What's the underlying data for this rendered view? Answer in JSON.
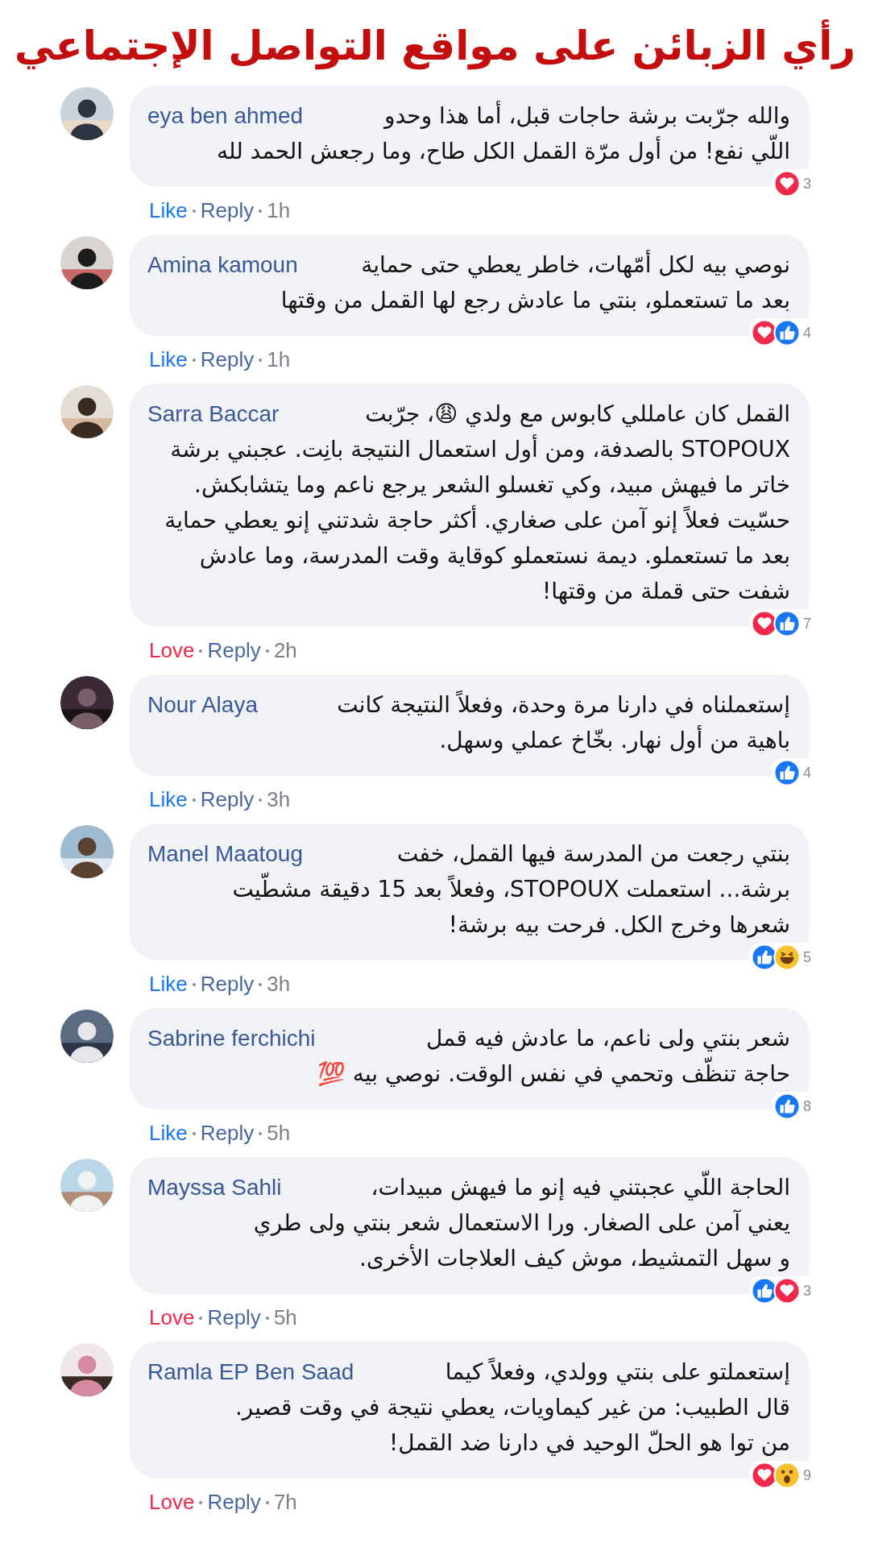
{
  "title": "رأي الزبائن على مواقع التواصل الإجتماعي",
  "comments": [
    {
      "name": "eya ben ahmed",
      "lines": [
        "والله جرّبت برشة حاجات قبل، أما هذا وحدو",
        "اللّي نفع! من أول مرّة القمل الكل طاح، وما رجعش الحمد لله"
      ],
      "reactions": [
        {
          "kind": "love"
        }
      ],
      "count": "3",
      "action": {
        "label": "Like",
        "kind": "like"
      },
      "reply": "Reply",
      "time": "1h"
    },
    {
      "name": "Amina kamoun",
      "lines": [
        "نوصي بيه لكل أمّهات، خاطر يعطي حتى حماية",
        "بعد ما تستعملو، بنتي ما عادش رجع لها القمل من وقتها"
      ],
      "reactions": [
        {
          "kind": "love"
        },
        {
          "kind": "like"
        }
      ],
      "count": "4",
      "action": {
        "label": "Like",
        "kind": "like"
      },
      "reply": "Reply",
      "time": "1h"
    },
    {
      "name": "Sarra Baccar",
      "lines": [
        "القمل كان عامللي كابوس مع ولدي 😩، جرّبت",
        "STOPOUX بالصدفة، ومن أول استعمال النتيجة بانِت. عجبني برشة",
        "خاتر ما فيهش مبيد، وكي تغسلو الشعر يرجع ناعم وما يتشابكش.",
        "حسّيت فعلاً إنو آمن على صغاري. أكثر حاجة شدتني إنو يعطي حماية",
        "بعد ما تستعملو. ديمة نستعملو كوقاية وقت المدرسة، وما عادش",
        "شفت حتى قملة من وقتها!"
      ],
      "reactions": [
        {
          "kind": "love"
        },
        {
          "kind": "like"
        }
      ],
      "count": "7",
      "action": {
        "label": "Love",
        "kind": "love"
      },
      "reply": "Reply",
      "time": "2h"
    },
    {
      "name": "Nour Alaya",
      "lines": [
        "إستعملناه في دارنا مرة وحدة، وفعلاً النتيجة كانت",
        "باهية من أول نهار. بخّاخ عملي وسهل."
      ],
      "reactions": [
        {
          "kind": "like"
        }
      ],
      "count": "4",
      "action": {
        "label": "Like",
        "kind": "like"
      },
      "reply": "Reply",
      "time": "3h"
    },
    {
      "name": "Manel Maatoug",
      "lines": [
        "بنتي رجعت من المدرسة فيها القمل، خفت",
        "برشة... استعملت STOPOUX،  وفعلاً بعد 15 دقيقة مشطّيت",
        "شعرها وخرج الكل. فرحت بيه برشة!"
      ],
      "reactions": [
        {
          "kind": "like"
        },
        {
          "kind": "haha"
        }
      ],
      "count": "5",
      "action": {
        "label": "Like",
        "kind": "like"
      },
      "reply": "Reply",
      "time": "3h"
    },
    {
      "name": "Sabrine ferchichi",
      "lines": [
        "شعر بنتي ولى ناعم، ما عادش فيه قمل",
        "حاجة تنظّف وتحمي في نفس الوقت. نوصي بيه 💯"
      ],
      "reactions": [
        {
          "kind": "like"
        }
      ],
      "count": "8",
      "action": {
        "label": "Like",
        "kind": "like"
      },
      "reply": "Reply",
      "time": "5h"
    },
    {
      "name": "Mayssa Sahli",
      "lines": [
        "الحاجة اللّي عجبتني فيه إنو ما فيهش مبيدات،",
        "يعني آمن على الصغار. ورا الاستعمال شعر بنتي ولى طري",
        "و سهل التمشيط، موش كيف العلاجات الأخرى."
      ],
      "reactions": [
        {
          "kind": "like"
        },
        {
          "kind": "love"
        }
      ],
      "count": "3",
      "action": {
        "label": "Love",
        "kind": "love"
      },
      "reply": "Reply",
      "time": "5h"
    },
    {
      "name": "Ramla EP Ben Saad",
      "lines": [
        "إستعملتو على بنتي وولدي، وفعلاً كيما",
        "قال الطبيب: من غير كيماويات، يعطي نتيجة في وقت قصير.",
        "من توا هو الحلّ الوحيد في دارنا ضد القمل!"
      ],
      "reactions": [
        {
          "kind": "love"
        },
        {
          "kind": "wow"
        }
      ],
      "count": "9",
      "action": {
        "label": "Love",
        "kind": "love"
      },
      "reply": "Reply",
      "time": "7h"
    }
  ]
}
